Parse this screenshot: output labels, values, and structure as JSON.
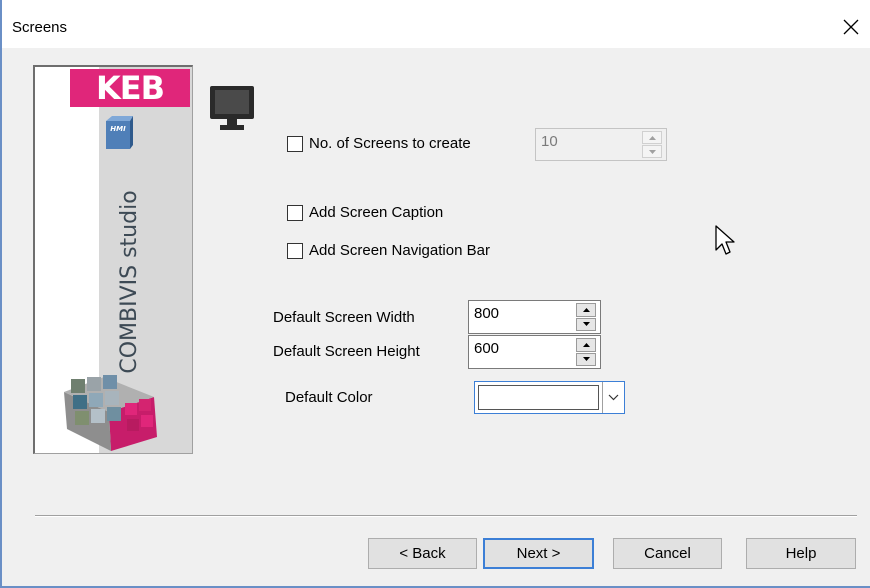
{
  "window": {
    "title": "Screens"
  },
  "banner": {
    "logo_text": "KEB",
    "badge_text": "HMI",
    "product_text": "COMBIVIS studio"
  },
  "options": {
    "screens_to_create": {
      "label": "No. of Screens to create",
      "checked": false,
      "value": "10",
      "enabled": false
    },
    "add_caption": {
      "label": "Add Screen Caption",
      "checked": false
    },
    "add_nav_bar": {
      "label": "Add Screen Navigation Bar",
      "checked": false
    }
  },
  "defaults": {
    "width": {
      "label": "Default Screen Width",
      "value": "800"
    },
    "height": {
      "label": "Default Screen Height",
      "value": "600"
    },
    "color": {
      "label": "Default Color",
      "value": ""
    }
  },
  "buttons": {
    "back": "< Back",
    "next": "Next >",
    "cancel": "Cancel",
    "help": "Help"
  },
  "colors": {
    "accent": "#3c7fd6",
    "keb_pink": "#e0267a",
    "dialog_bg": "#f0f0f0"
  },
  "icons": {
    "close": "close-icon",
    "monitor": "monitor-icon",
    "spin_up": "chevron-up-icon",
    "spin_down": "chevron-down-icon",
    "dropdown": "chevron-down-icon",
    "cursor": "mouse-pointer-icon"
  }
}
